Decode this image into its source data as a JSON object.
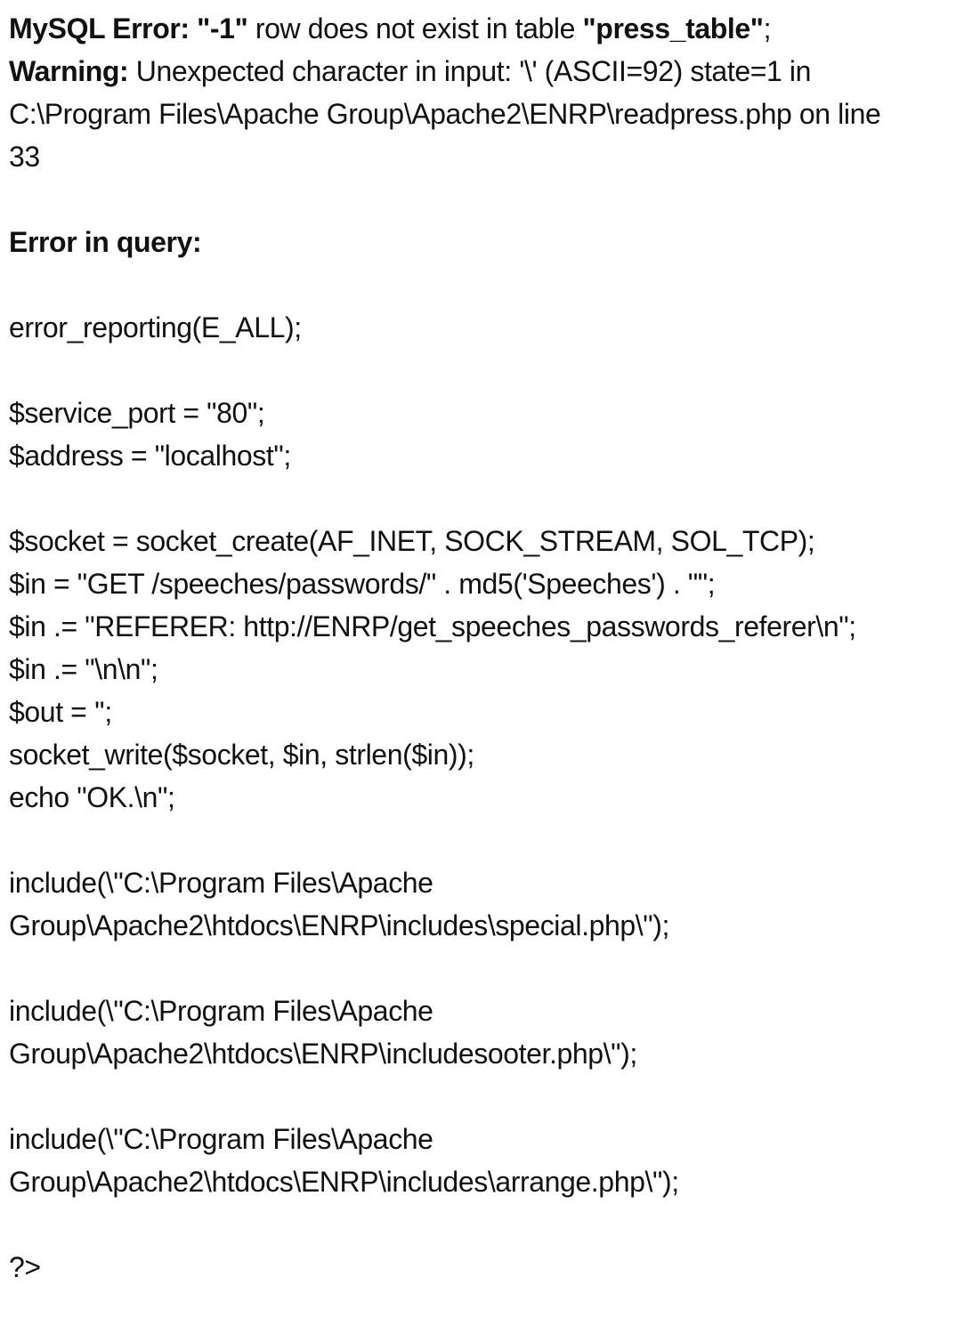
{
  "error": {
    "mysql_label": "MySQL Error:",
    "row_value": "\"-1\"",
    "row_text": " row does not exist in table ",
    "table_name": "\"press_table\"",
    "terminator": ";",
    "warning_label": "Warning:",
    "warning_text": " Unexpected character in input: '\\' (ASCII=92) state=1 in",
    "warning_path": "C:\\Program Files\\Apache Group\\Apache2\\ENRP\\readpress.php on line",
    "warning_line": "33",
    "query_heading": "Error in query:"
  },
  "code": {
    "l1": "error_reporting(E_ALL);",
    "l2": "$service_port = \"80\";",
    "l3": "$address = \"localhost\";",
    "l4": "$socket = socket_create(AF_INET, SOCK_STREAM, SOL_TCP);",
    "l5": "$in = \"GET /speeches/passwords/\" . md5('Speeches') . \"\";",
    "l6": "$in .= \"REFERER: http://ENRP/get_speeches_passwords_referer\\n\";",
    "l7": "$in .= \"\\n\\n\";",
    "l8": "$out = '';",
    "l9": "socket_write($socket, $in, strlen($in));",
    "l10": "echo \"OK.\\n\";",
    "inc1a": "include(\\\"C:\\Program Files\\Apache",
    "inc1b": "Group\\Apache2\\htdocs\\ENRP\\includes\\special.php\\\");",
    "inc2a": "include(\\\"C:\\Program Files\\Apache",
    "inc2b": "Group\\Apache2\\htdocs\\ENRP\\includesooter.php\\\");",
    "inc3a": "include(\\\"C:\\Program Files\\Apache",
    "inc3b": "Group\\Apache2\\htdocs\\ENRP\\includes\\arrange.php\\\");",
    "close": "?>"
  }
}
